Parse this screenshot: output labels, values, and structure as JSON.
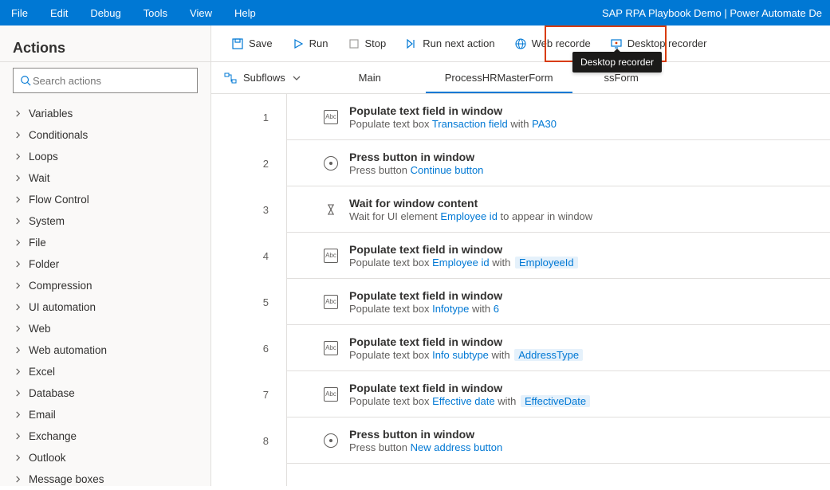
{
  "app_title": "SAP RPA Playbook Demo | Power Automate De",
  "menu": [
    "File",
    "Edit",
    "Debug",
    "Tools",
    "View",
    "Help"
  ],
  "toolbar": {
    "save": "Save",
    "run": "Run",
    "stop": "Stop",
    "run_next": "Run next action",
    "web_rec": "Web recorde",
    "desktop_rec": "Desktop recorder"
  },
  "tooltip": "Desktop recorder",
  "sidebar": {
    "title": "Actions",
    "search_placeholder": "Search actions",
    "categories": [
      "Variables",
      "Conditionals",
      "Loops",
      "Wait",
      "Flow Control",
      "System",
      "File",
      "Folder",
      "Compression",
      "UI automation",
      "Web",
      "Web automation",
      "Excel",
      "Database",
      "Email",
      "Exchange",
      "Outlook",
      "Message boxes"
    ]
  },
  "subflows_label": "Subflows",
  "tabs": [
    {
      "label": "Main",
      "active": false
    },
    {
      "label": "ProcessHRMasterForm",
      "active": true
    },
    {
      "label": "ssForm",
      "active": false,
      "partial": true
    }
  ],
  "steps": [
    {
      "n": "1",
      "icon": "abc",
      "title": "Populate text field in window",
      "desc_prefix": "Populate text box ",
      "link": "Transaction field",
      "desc_mid": " with ",
      "link2": "PA30"
    },
    {
      "n": "2",
      "icon": "btn",
      "title": "Press button in window",
      "desc_prefix": "Press button ",
      "link": "Continue button"
    },
    {
      "n": "3",
      "icon": "wait",
      "title": "Wait for window content",
      "desc_prefix": "Wait for UI element ",
      "link": "Employee id",
      "desc_suffix": " to appear in window"
    },
    {
      "n": "4",
      "icon": "abc",
      "title": "Populate text field in window",
      "desc_prefix": "Populate text box ",
      "link": "Employee id",
      "desc_mid": " with ",
      "var": "EmployeeId"
    },
    {
      "n": "5",
      "icon": "abc",
      "title": "Populate text field in window",
      "desc_prefix": "Populate text box ",
      "link": "Infotype",
      "desc_mid": " with ",
      "link2": "6"
    },
    {
      "n": "6",
      "icon": "abc",
      "title": "Populate text field in window",
      "desc_prefix": "Populate text box ",
      "link": "Info subtype",
      "desc_mid": " with ",
      "var": "AddressType"
    },
    {
      "n": "7",
      "icon": "abc",
      "title": "Populate text field in window",
      "desc_prefix": "Populate text box ",
      "link": "Effective date",
      "desc_mid": " with ",
      "var": "EffectiveDate"
    },
    {
      "n": "8",
      "icon": "btn",
      "title": "Press button in window",
      "desc_prefix": "Press button ",
      "link": "New address button"
    }
  ]
}
